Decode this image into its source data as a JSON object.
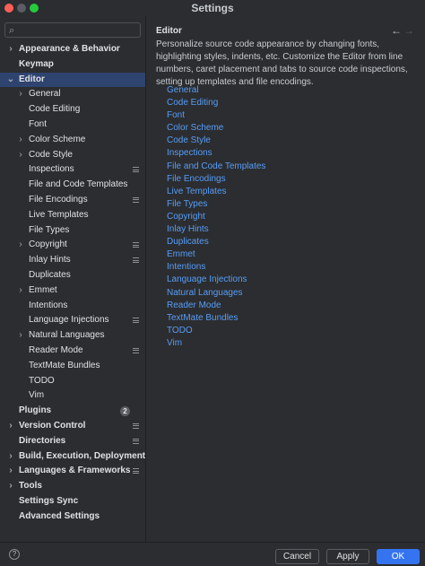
{
  "window": {
    "title": "Settings"
  },
  "search": {
    "placeholder": ""
  },
  "sidebar": {
    "items": [
      {
        "label": "Appearance & Behavior",
        "level": 0,
        "expandable": true,
        "expanded": false,
        "bold": true,
        "selected": false
      },
      {
        "label": "Keymap",
        "level": 0,
        "expandable": false,
        "bold": true,
        "selected": false
      },
      {
        "label": "Editor",
        "level": 0,
        "expandable": true,
        "expanded": true,
        "bold": true,
        "selected": true
      },
      {
        "label": "General",
        "level": 1,
        "expandable": true,
        "expanded": false,
        "bold": false,
        "selected": false
      },
      {
        "label": "Code Editing",
        "level": 1,
        "expandable": false,
        "bold": false,
        "selected": false
      },
      {
        "label": "Font",
        "level": 1,
        "expandable": false,
        "bold": false,
        "selected": false
      },
      {
        "label": "Color Scheme",
        "level": 1,
        "expandable": true,
        "expanded": false,
        "bold": false,
        "selected": false
      },
      {
        "label": "Code Style",
        "level": 1,
        "expandable": true,
        "expanded": false,
        "bold": false,
        "selected": false
      },
      {
        "label": "Inspections",
        "level": 1,
        "expandable": false,
        "bold": false,
        "selected": false,
        "project_icon": true
      },
      {
        "label": "File and Code Templates",
        "level": 1,
        "expandable": false,
        "bold": false,
        "selected": false
      },
      {
        "label": "File Encodings",
        "level": 1,
        "expandable": false,
        "bold": false,
        "selected": false,
        "project_icon": true
      },
      {
        "label": "Live Templates",
        "level": 1,
        "expandable": false,
        "bold": false,
        "selected": false
      },
      {
        "label": "File Types",
        "level": 1,
        "expandable": false,
        "bold": false,
        "selected": false
      },
      {
        "label": "Copyright",
        "level": 1,
        "expandable": true,
        "expanded": false,
        "bold": false,
        "selected": false,
        "project_icon": true
      },
      {
        "label": "Inlay Hints",
        "level": 1,
        "expandable": false,
        "bold": false,
        "selected": false,
        "project_icon": true
      },
      {
        "label": "Duplicates",
        "level": 1,
        "expandable": false,
        "bold": false,
        "selected": false
      },
      {
        "label": "Emmet",
        "level": 1,
        "expandable": true,
        "expanded": false,
        "bold": false,
        "selected": false
      },
      {
        "label": "Intentions",
        "level": 1,
        "expandable": false,
        "bold": false,
        "selected": false
      },
      {
        "label": "Language Injections",
        "level": 1,
        "expandable": false,
        "bold": false,
        "selected": false,
        "project_icon": true
      },
      {
        "label": "Natural Languages",
        "level": 1,
        "expandable": true,
        "expanded": false,
        "bold": false,
        "selected": false
      },
      {
        "label": "Reader Mode",
        "level": 1,
        "expandable": false,
        "bold": false,
        "selected": false,
        "project_icon": true
      },
      {
        "label": "TextMate Bundles",
        "level": 1,
        "expandable": false,
        "bold": false,
        "selected": false
      },
      {
        "label": "TODO",
        "level": 1,
        "expandable": false,
        "bold": false,
        "selected": false
      },
      {
        "label": "Vim",
        "level": 1,
        "expandable": false,
        "bold": false,
        "selected": false
      },
      {
        "label": "Plugins",
        "level": 0,
        "expandable": false,
        "bold": true,
        "selected": false,
        "badge": "2"
      },
      {
        "label": "Version Control",
        "level": 0,
        "expandable": true,
        "expanded": false,
        "bold": true,
        "selected": false,
        "project_icon": true
      },
      {
        "label": "Directories",
        "level": 0,
        "expandable": false,
        "bold": true,
        "selected": false,
        "project_icon": true
      },
      {
        "label": "Build, Execution, Deployment",
        "level": 0,
        "expandable": true,
        "expanded": false,
        "bold": true,
        "selected": false
      },
      {
        "label": "Languages & Frameworks",
        "level": 0,
        "expandable": true,
        "expanded": false,
        "bold": true,
        "selected": false,
        "project_icon": true
      },
      {
        "label": "Tools",
        "level": 0,
        "expandable": true,
        "expanded": false,
        "bold": true,
        "selected": false
      },
      {
        "label": "Settings Sync",
        "level": 0,
        "expandable": false,
        "bold": true,
        "selected": false
      },
      {
        "label": "Advanced Settings",
        "level": 0,
        "expandable": false,
        "bold": true,
        "selected": false
      }
    ]
  },
  "content": {
    "heading": "Editor",
    "description": "Personalize source code appearance by changing fonts, highlighting styles, indents, etc. Customize the Editor from line numbers, caret placement and tabs to source code inspections, setting up templates and file encodings.",
    "links": [
      "General",
      "Code Editing",
      "Font",
      "Color Scheme",
      "Code Style",
      "Inspections",
      "File and Code Templates",
      "File Encodings",
      "Live Templates",
      "File Types",
      "Copyright",
      "Inlay Hints",
      "Duplicates",
      "Emmet",
      "Intentions",
      "Language Injections",
      "Natural Languages",
      "Reader Mode",
      "TextMate Bundles",
      "TODO",
      "Vim"
    ]
  },
  "footer": {
    "help": "?",
    "cancel": "Cancel",
    "apply": "Apply",
    "ok": "OK"
  },
  "icons": {
    "search": "search-icon",
    "back": "arrow-left-icon",
    "forward": "arrow-right-icon",
    "expand": "chevron-right-icon",
    "collapse": "chevron-down-icon",
    "project_scope": "project-scope-icon",
    "help": "help-icon"
  },
  "colors": {
    "background": "#2b2d30",
    "selection": "#2e436e",
    "link": "#589df6",
    "primary_button": "#3574f0"
  }
}
